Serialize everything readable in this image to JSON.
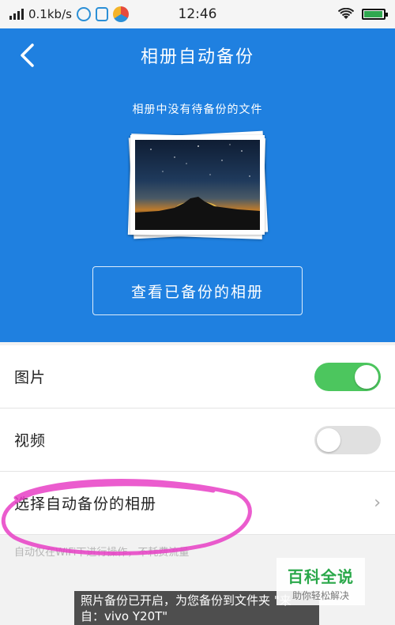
{
  "status_bar": {
    "speed": "0.1kb/s",
    "time": "12:46",
    "battery_level": 0.95,
    "icons": [
      "signal-icon",
      "network-speed-icon",
      "notification-icon",
      "shield-icon",
      "app-icon",
      "wifi-icon",
      "battery-icon"
    ]
  },
  "header": {
    "title": "相册自动备份",
    "back_icon": "chevron-left-icon",
    "hint": "相册中没有待备份的文件",
    "view_button": "查看已备份的相册"
  },
  "settings": {
    "photos_label": "图片",
    "photos_on": true,
    "videos_label": "视频",
    "videos_on": false,
    "select_album_label": "选择自动备份的相册",
    "chevron": "›"
  },
  "note": "自动仅在WiFi下进行操作，不耗费流量",
  "toast": "照片备份已开启，为您备份到文件夹 \"来自：vivo Y20T\"",
  "watermark": {
    "title": "百科全说",
    "subtitle": "助你轻松解决"
  },
  "colors": {
    "primary": "#1f80e0",
    "toggle_on": "#4cc65e",
    "toggle_off": "#e0e0e0",
    "highlight": "#e83fc6"
  }
}
